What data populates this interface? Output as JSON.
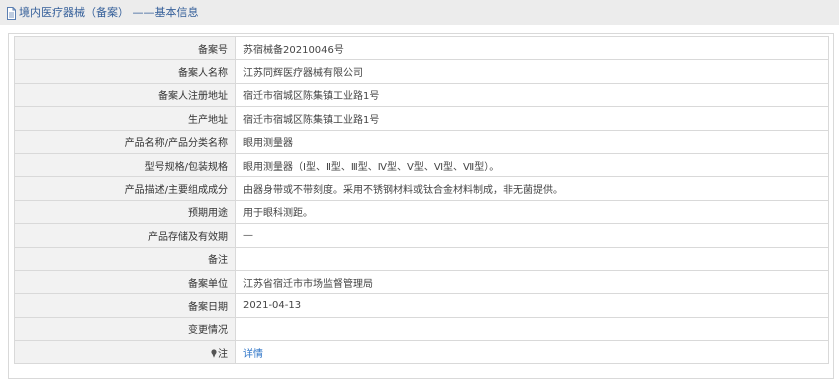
{
  "header": {
    "title": "境内医疗器械（备案） ——基本信息"
  },
  "rows": [
    {
      "label": "备案号",
      "value": "苏宿械备20210046号"
    },
    {
      "label": "备案人名称",
      "value": "江苏同辉医疗器械有限公司"
    },
    {
      "label": "备案人注册地址",
      "value": "宿迁市宿城区陈集镇工业路1号"
    },
    {
      "label": "生产地址",
      "value": "宿迁市宿城区陈集镇工业路1号"
    },
    {
      "label": "产品名称/产品分类名称",
      "value": "眼用测量器"
    },
    {
      "label": "型号规格/包装规格",
      "value": "眼用测量器（Ⅰ型、Ⅱ型、Ⅲ型、Ⅳ型、Ⅴ型、Ⅵ型、Ⅶ型）。"
    },
    {
      "label": "产品描述/主要组成成分",
      "value": "由器身带或不带刻度。采用不锈钢材料或钛合金材料制成，非无菌提供。"
    },
    {
      "label": "预期用途",
      "value": "用于眼科测距。"
    },
    {
      "label": "产品存储及有效期",
      "value": "—"
    },
    {
      "label": "备注",
      "value": ""
    },
    {
      "label": "备案单位",
      "value": "江苏省宿迁市市场监督管理局"
    },
    {
      "label": "备案日期",
      "value": "2021-04-13"
    },
    {
      "label": "变更情况",
      "value": ""
    }
  ],
  "note_row": {
    "label": "注",
    "link_label": "详情"
  },
  "colors": {
    "title": "#36609a",
    "label_bg": "#f2f2f2",
    "border": "#d9d9d9",
    "link": "#2d74c7"
  }
}
